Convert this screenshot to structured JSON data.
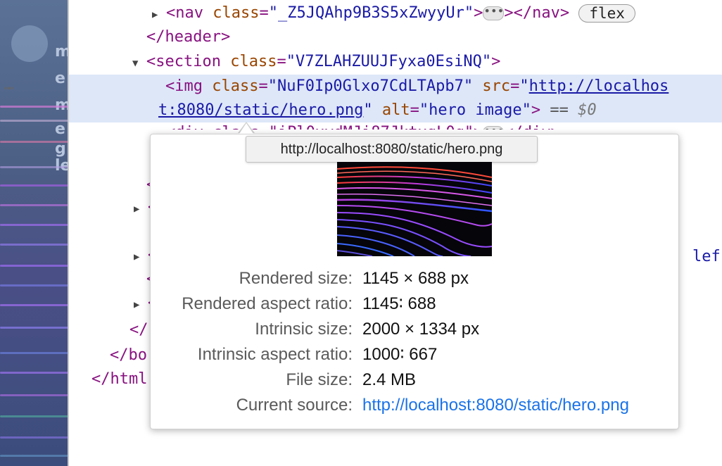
{
  "preview": {
    "letters": [
      "m",
      "e",
      "m",
      "e",
      "g",
      "le"
    ]
  },
  "tree": {
    "nav_open": "<nav",
    "nav_class_attr": "class",
    "nav_class_val": "\"_Z5JQAhp9B3S5xZwyyUr\"",
    "nav_close": "></nav>",
    "flex_badge": "flex",
    "header_close": "</header>",
    "section_open": "<section",
    "section_class_attr": "class",
    "section_class_val": "\"V7ZLAHZUUJFyxa0EsiNQ\"",
    "section_gt": ">",
    "img_open": "<img",
    "img_class_attr": "class",
    "img_class_val": "\"NuF0Ip0Glxo7CdLTApb7\"",
    "img_src_attr": "src",
    "img_src_q": "\"",
    "img_src_link_part1": "http://localhos",
    "img_src_link_part2": "t:8080/static/hero.png",
    "img_alt_attr": "alt",
    "img_alt_val": "\"hero image\"",
    "img_gt": ">",
    "eq": "==",
    "dollar": "$0",
    "div_partial": "<div class=\"iPl0xydMJi87JktxgL0q\">",
    "div_close": "</div>",
    "frag_lt": "<",
    "frag_left": "lef",
    "close_tag1": "</",
    "body_close": "</bo",
    "html_close": "</html",
    "ellipsis": "…"
  },
  "url_tooltip": "http://localhost:8080/static/hero.png",
  "popup": {
    "rows": [
      {
        "label": "Rendered size:",
        "value": "1145 × 688 px"
      },
      {
        "label": "Rendered aspect ratio:",
        "value": "1145∶ 688"
      },
      {
        "label": "Intrinsic size:",
        "value": "2000 × 1334 px"
      },
      {
        "label": "Intrinsic aspect ratio:",
        "value": "1000∶ 667"
      },
      {
        "label": "File size:",
        "value": "2.4 MB"
      },
      {
        "label": "Current source:",
        "value": "http://localhost:8080/static/hero.png"
      }
    ]
  },
  "colors": {
    "tag": "#881280",
    "attr": "#994500",
    "value": "#1a1aa6",
    "selected_bg": "#dde7f8",
    "link": "#1a73e8"
  }
}
